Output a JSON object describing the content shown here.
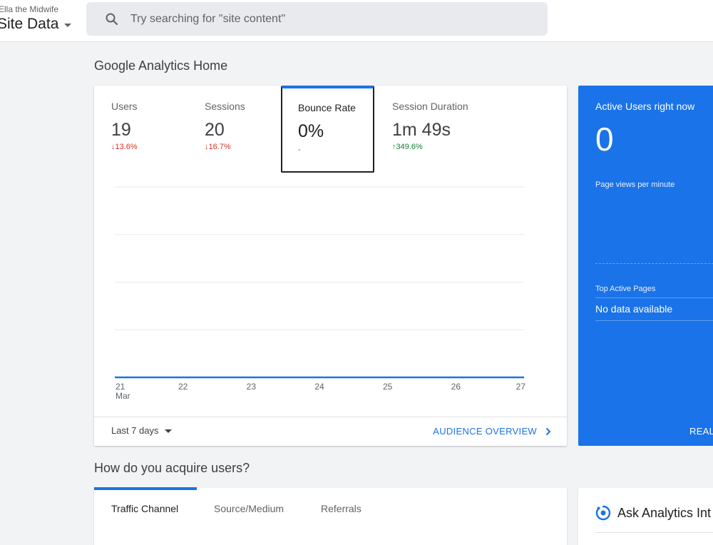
{
  "header": {
    "account_name": "Ella the Midwife",
    "property_name": "Site Data",
    "search_placeholder": "Try searching for \"site content\""
  },
  "home": {
    "title": "Google Analytics Home",
    "metrics": [
      {
        "label": "Users",
        "value": "19",
        "change": "↓13.6%",
        "trend": "down"
      },
      {
        "label": "Sessions",
        "value": "20",
        "change": "↓16.7%",
        "trend": "down"
      },
      {
        "label": "Bounce Rate",
        "value": "0%",
        "change": "-",
        "trend": "none"
      },
      {
        "label": "Session Duration",
        "value": "1m 49s",
        "change": "↑349.6%",
        "trend": "up"
      }
    ],
    "selected_metric": "Bounce Rate",
    "date_range": "Last 7 days",
    "audience_link": "AUDIENCE OVERVIEW"
  },
  "chart_data": {
    "type": "line",
    "x": [
      "21",
      "22",
      "23",
      "24",
      "25",
      "26",
      "27"
    ],
    "x_sublabel": "Mar",
    "series": [
      {
        "values": [
          0,
          0,
          0,
          0,
          0,
          0,
          0
        ]
      }
    ],
    "grid": true,
    "color": "#1a73e8"
  },
  "realtime": {
    "title": "Active Users right now",
    "value": "0",
    "subtitle": "Page views per minute",
    "top_pages_label": "Top Active Pages",
    "no_data": "No data available",
    "link": "REAL"
  },
  "acquisition": {
    "title": "How do you acquire users?",
    "tabs": [
      "Traffic Channel",
      "Source/Medium",
      "Referrals"
    ]
  },
  "ask": {
    "title": "Ask Analytics Int"
  },
  "colors": {
    "accent": "#1a73e8",
    "down": "#d93025",
    "up": "#188038"
  }
}
